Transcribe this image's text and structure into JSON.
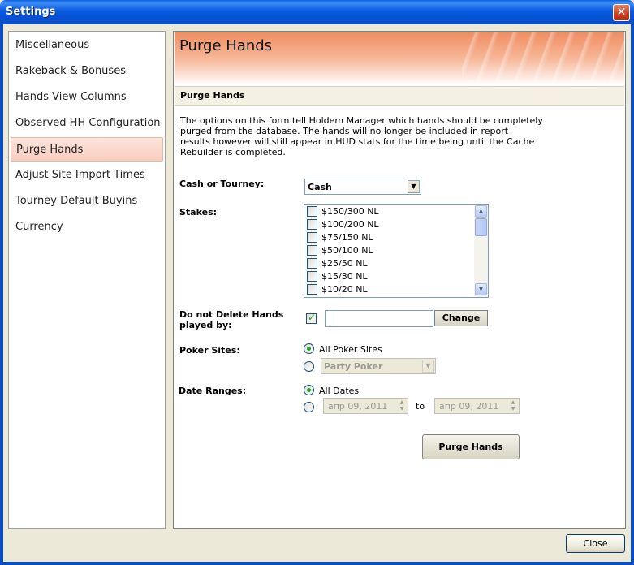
{
  "window": {
    "title": "Settings"
  },
  "sidebar": {
    "items": [
      {
        "label": "Miscellaneous"
      },
      {
        "label": "Rakeback & Bonuses"
      },
      {
        "label": "Hands View Columns"
      },
      {
        "label": "Observed HH Configuration"
      },
      {
        "label": "Purge Hands"
      },
      {
        "label": "Adjust Site Import Times"
      },
      {
        "label": "Tourney Default Buyins"
      },
      {
        "label": "Currency"
      }
    ],
    "active_index": 4
  },
  "main": {
    "banner_title": "Purge Hands",
    "section_title": "Purge Hands",
    "intro": "The options on this form tell Holdem Manager which hands should be completely\npurged from the database.  The hands will no longer be included in report\nresults however will still appear in HUD stats for the time being until the Cache\nRebuilder is completed.",
    "cash_or_tourney": {
      "label": "Cash or Tourney:",
      "value": "Cash"
    },
    "stakes": {
      "label": "Stakes:",
      "items": [
        "$150/300 NL",
        "$100/200 NL",
        "$75/150 NL",
        "$50/100 NL",
        "$25/50 NL",
        "$15/30 NL",
        "$10/20 NL"
      ]
    },
    "do_not_delete": {
      "label_line1": "Do not Delete Hands",
      "label_line2": "played by:",
      "checked": true,
      "value": "",
      "change_label": "Change"
    },
    "poker_sites": {
      "label": "Poker Sites:",
      "all_label": "All Poker Sites",
      "selected_site": "Party Poker"
    },
    "date_ranges": {
      "label": "Date Ranges:",
      "all_label": "All Dates",
      "from": "апр 09, 2011",
      "to_label": "to",
      "to": "апр 09, 2011"
    },
    "purge_button": "Purge Hands"
  },
  "footer": {
    "close_label": "Close"
  }
}
